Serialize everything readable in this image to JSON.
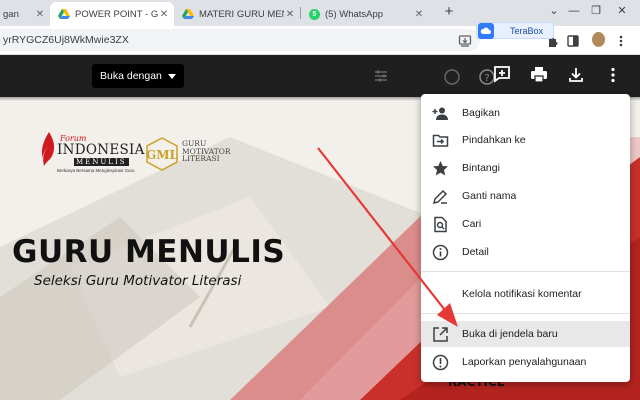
{
  "browser": {
    "tabs": [
      {
        "label": "gan",
        "active": false
      },
      {
        "label": "POWER POINT - Go",
        "active": true,
        "icon": "google-drive-icon"
      },
      {
        "label": "MATERI GURU MEN",
        "active": false,
        "icon": "google-drive-icon"
      },
      {
        "label": "(5) WhatsApp",
        "active": false,
        "icon": "whatsapp-icon",
        "badge": "5"
      }
    ],
    "new_tab_symbol": "+",
    "url_fragment": "yrRYGCZ6Uj8WkMwie3ZX",
    "extension_popup_label": "TeraBox"
  },
  "viewer": {
    "open_with_label": "Buka dengan",
    "header_icons": [
      "add-comment-icon",
      "print-icon",
      "download-icon",
      "more-vert-icon"
    ]
  },
  "slide": {
    "logo1": {
      "forum": "Forum",
      "name": "INDONESIA",
      "sub": "MENULIS",
      "tagline": "Berkarya Bersama Menginspirasi Guru"
    },
    "logo2": {
      "monogram": "GML",
      "line1": "GURU",
      "line2": "MOTIVATOR",
      "line3": "LITERASI"
    },
    "title": "GURU MENULIS",
    "subtitle": "Seleksi Guru Motivator Literasi",
    "bottom_text": "RACTICE"
  },
  "menu": {
    "items": [
      {
        "label": "Bagikan",
        "icon": "add-person-icon"
      },
      {
        "label": "Pindahkan ke",
        "icon": "move-to-folder-icon"
      },
      {
        "label": "Bintangi",
        "icon": "star-icon"
      },
      {
        "label": "Ganti nama",
        "icon": "pencil-icon"
      },
      {
        "label": "Cari",
        "icon": "search-file-icon"
      },
      {
        "label": "Detail",
        "icon": "info-icon"
      },
      {
        "label": "Kelola notifikasi komentar",
        "icon": "bell-icon"
      },
      {
        "label": "Buka di jendela baru",
        "icon": "open-new-window-icon",
        "highlighted": true
      },
      {
        "label": "Laporkan penyalahgunaan",
        "icon": "report-icon"
      }
    ]
  },
  "colors": {
    "accent_red": "#e53935",
    "highlight": "#e8e8e8",
    "viewer_bg": "#1f1f1f"
  }
}
